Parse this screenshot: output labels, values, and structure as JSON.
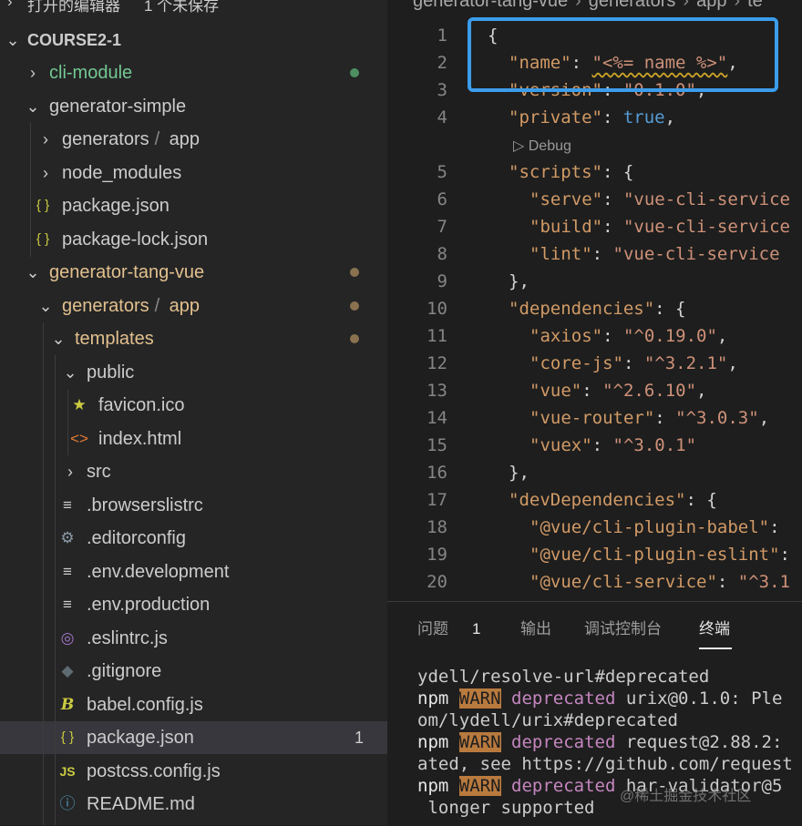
{
  "sidebar": {
    "open_editors_label": "打开的编辑器",
    "unsaved_label": "1 个未保存",
    "root_label": "COURSE2-1",
    "tree": [
      {
        "label": "cli-module",
        "chevron": "›",
        "indent": 30,
        "color": "#73c991",
        "dot": "#4e8f62"
      },
      {
        "label": "generator-simple",
        "chevron": "⌄",
        "indent": 30,
        "color": "#cccccc"
      },
      {
        "label": "generators",
        "label2": "app",
        "chevron": "›",
        "indent": 44,
        "color": "#cccccc"
      },
      {
        "label": "node_modules",
        "chevron": "›",
        "indent": 44,
        "color": "#cccccc"
      },
      {
        "label": "package.json",
        "icon": "{ }",
        "iconName": "json-icon",
        "iconColor": "#cbcb41",
        "indent": 44,
        "color": "#cccccc"
      },
      {
        "label": "package-lock.json",
        "icon": "{ }",
        "iconName": "json-icon",
        "iconColor": "#cbcb41",
        "indent": 44,
        "color": "#cccccc"
      },
      {
        "label": "generator-tang-vue",
        "chevron": "⌄",
        "indent": 30,
        "color": "#e2c08d",
        "dot": "#8a7250"
      },
      {
        "label": "generators",
        "label2": "app",
        "chevron": "⌄",
        "indent": 44,
        "color": "#e2c08d",
        "dot": "#8a7250"
      },
      {
        "label": "templates",
        "chevron": "⌄",
        "indent": 58,
        "color": "#e2c08d",
        "dot": "#8a7250"
      },
      {
        "label": "public",
        "chevron": "⌄",
        "indent": 71,
        "color": "#cccccc"
      },
      {
        "label": "favicon.ico",
        "icon": "★",
        "iconName": "star-icon",
        "iconColor": "#cbcb41",
        "indent": 84,
        "color": "#cccccc"
      },
      {
        "label": "index.html",
        "icon": "<>",
        "iconName": "html-icon",
        "iconColor": "#e37933",
        "indent": 84,
        "color": "#cccccc"
      },
      {
        "label": "src",
        "chevron": "›",
        "indent": 71,
        "color": "#cccccc"
      },
      {
        "label": ".browserslistrc",
        "icon": "≡",
        "iconName": "lines-icon",
        "iconColor": "#cccccc",
        "indent": 71,
        "color": "#cccccc"
      },
      {
        "label": ".editorconfig",
        "icon": "⚙",
        "iconName": "gear-icon",
        "iconColor": "#8a9ba8",
        "indent": 71,
        "color": "#cccccc"
      },
      {
        "label": ".env.development",
        "icon": "≡",
        "iconName": "lines-icon",
        "iconColor": "#cccccc",
        "indent": 71,
        "color": "#cccccc"
      },
      {
        "label": ".env.production",
        "icon": "≡",
        "iconName": "lines-icon",
        "iconColor": "#cccccc",
        "indent": 71,
        "color": "#cccccc"
      },
      {
        "label": ".eslintrc.js",
        "icon": "◎",
        "iconName": "eslint-icon",
        "iconColor": "#a074c4",
        "indent": 71,
        "color": "#cccccc"
      },
      {
        "label": ".gitignore",
        "icon": "◆",
        "iconName": "git-icon",
        "iconColor": "#5f6b73",
        "indent": 71,
        "color": "#cccccc"
      },
      {
        "label": "babel.config.js",
        "icon": "B",
        "iconName": "babel-icon",
        "iconColor": "#cbcb41",
        "indent": 71,
        "color": "#cccccc"
      },
      {
        "label": "package.json",
        "icon": "{ }",
        "iconName": "json-icon",
        "iconColor": "#cbcb41",
        "indent": 71,
        "color": "#cccccc",
        "selected": true,
        "badge": "1"
      },
      {
        "label": "postcss.config.js",
        "icon": "JS",
        "iconName": "js-icon",
        "iconColor": "#cbcb41",
        "indent": 71,
        "color": "#cccccc"
      },
      {
        "label": "README.md",
        "icon": "ⓘ",
        "iconName": "info-icon",
        "iconColor": "#519aba",
        "indent": 71,
        "color": "#cccccc"
      }
    ]
  },
  "breadcrumbs": [
    "generator-tang-vue",
    "generators",
    "app",
    "te"
  ],
  "codelens": "▷ Debug",
  "code": [
    {
      "n": "1",
      "indent": 0,
      "parts": [
        [
          "p",
          "{"
        ]
      ]
    },
    {
      "n": "2",
      "indent": 1,
      "parts": [
        [
          "key",
          "\"name\""
        ],
        [
          "p",
          ": "
        ],
        [
          "sv wavy",
          "\"<%= name %>\""
        ],
        [
          "p",
          ","
        ]
      ]
    },
    {
      "n": "3",
      "indent": 1,
      "parts": [
        [
          "key",
          "\"version\""
        ],
        [
          "p",
          ": "
        ],
        [
          "sv",
          "\"0.1.0\""
        ],
        [
          "p",
          ","
        ]
      ]
    },
    {
      "n": "4",
      "indent": 1,
      "parts": [
        [
          "key",
          "\"private\""
        ],
        [
          "p",
          ": "
        ],
        [
          "b",
          "true"
        ],
        [
          "p",
          ","
        ]
      ]
    },
    {
      "n": "5",
      "indent": 1,
      "parts": [
        [
          "key",
          "\"scripts\""
        ],
        [
          "p",
          ": {"
        ]
      ]
    },
    {
      "n": "6",
      "indent": 2,
      "parts": [
        [
          "key",
          "\"serve\""
        ],
        [
          "p",
          ": "
        ],
        [
          "sv",
          "\"vue-cli-service"
        ]
      ]
    },
    {
      "n": "7",
      "indent": 2,
      "parts": [
        [
          "key",
          "\"build\""
        ],
        [
          "p",
          ": "
        ],
        [
          "sv",
          "\"vue-cli-service"
        ]
      ]
    },
    {
      "n": "8",
      "indent": 2,
      "parts": [
        [
          "key",
          "\"lint\""
        ],
        [
          "p",
          ": "
        ],
        [
          "sv",
          "\"vue-cli-service"
        ]
      ]
    },
    {
      "n": "9",
      "indent": 1,
      "parts": [
        [
          "p",
          "},"
        ]
      ]
    },
    {
      "n": "10",
      "indent": 1,
      "parts": [
        [
          "key",
          "\"dependencies\""
        ],
        [
          "p",
          ": {"
        ]
      ]
    },
    {
      "n": "11",
      "indent": 2,
      "parts": [
        [
          "key",
          "\"axios\""
        ],
        [
          "p",
          ": "
        ],
        [
          "sv",
          "\"^0.19.0\""
        ],
        [
          "p",
          ","
        ]
      ]
    },
    {
      "n": "12",
      "indent": 2,
      "parts": [
        [
          "key",
          "\"core-js\""
        ],
        [
          "p",
          ": "
        ],
        [
          "sv",
          "\"^3.2.1\""
        ],
        [
          "p",
          ","
        ]
      ]
    },
    {
      "n": "13",
      "indent": 2,
      "parts": [
        [
          "key",
          "\"vue\""
        ],
        [
          "p",
          ": "
        ],
        [
          "sv",
          "\"^2.6.10\""
        ],
        [
          "p",
          ","
        ]
      ]
    },
    {
      "n": "14",
      "indent": 2,
      "parts": [
        [
          "key",
          "\"vue-router\""
        ],
        [
          "p",
          ": "
        ],
        [
          "sv",
          "\"^3.0.3\""
        ],
        [
          "p",
          ","
        ]
      ]
    },
    {
      "n": "15",
      "indent": 2,
      "parts": [
        [
          "key",
          "\"vuex\""
        ],
        [
          "p",
          ": "
        ],
        [
          "sv",
          "\"^3.0.1\""
        ]
      ]
    },
    {
      "n": "16",
      "indent": 1,
      "parts": [
        [
          "p",
          "},"
        ]
      ]
    },
    {
      "n": "17",
      "indent": 1,
      "parts": [
        [
          "key",
          "\"devDependencies\""
        ],
        [
          "p",
          ": {"
        ]
      ]
    },
    {
      "n": "18",
      "indent": 2,
      "parts": [
        [
          "key",
          "\"@vue/cli-plugin-babel\""
        ],
        [
          "p",
          ": "
        ]
      ]
    },
    {
      "n": "19",
      "indent": 2,
      "parts": [
        [
          "key",
          "\"@vue/cli-plugin-eslint\""
        ],
        [
          "p",
          ":"
        ]
      ]
    },
    {
      "n": "20",
      "indent": 2,
      "parts": [
        [
          "key",
          "\"@vue/cli-service\""
        ],
        [
          "p",
          ": "
        ],
        [
          "sv",
          "\"^3.1"
        ]
      ]
    }
  ],
  "panel": {
    "tabs": [
      {
        "label": "问题",
        "count": "1"
      },
      {
        "label": "输出"
      },
      {
        "label": "调试控制台"
      },
      {
        "label": "终端",
        "active": true
      }
    ]
  },
  "terminal": [
    [
      [
        "t",
        "ydell/resolve-url#deprecated"
      ]
    ],
    [
      [
        "npm",
        "npm"
      ],
      [
        "t",
        " "
      ],
      [
        "warn",
        "WARN"
      ],
      [
        "t",
        " "
      ],
      [
        "dep",
        "deprecated"
      ],
      [
        "t",
        " urix@0.1.0: Ple"
      ]
    ],
    [
      [
        "t",
        "om/lydell/urix#deprecated"
      ]
    ],
    [
      [
        "npm",
        "npm"
      ],
      [
        "t",
        " "
      ],
      [
        "warn",
        "WARN"
      ],
      [
        "t",
        " "
      ],
      [
        "dep",
        "deprecated"
      ],
      [
        "t",
        " request@2.88.2:"
      ]
    ],
    [
      [
        "t",
        "ated, see https://github.com/request"
      ]
    ],
    [
      [
        "npm",
        "npm"
      ],
      [
        "t",
        " "
      ],
      [
        "warn",
        "WARN"
      ],
      [
        "t",
        " "
      ],
      [
        "dep",
        "deprecated"
      ],
      [
        "t",
        " har-validator@5"
      ]
    ],
    [
      [
        "t",
        " longer supported"
      ]
    ]
  ],
  "watermark": "@稀土掘金技术社区"
}
